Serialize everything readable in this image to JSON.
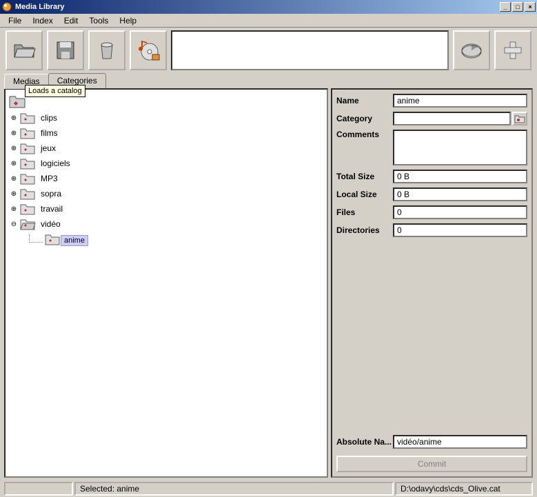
{
  "window": {
    "title": "Media Library"
  },
  "menu": {
    "file": "File",
    "index": "Index",
    "edit": "Edit",
    "tools": "Tools",
    "help": "Help"
  },
  "tooltip": "Loads a catalog",
  "tabs": {
    "medias": "Medias",
    "categories": "Categories"
  },
  "tree": {
    "items": [
      {
        "label": "clips"
      },
      {
        "label": "films"
      },
      {
        "label": "jeux"
      },
      {
        "label": "logiciels"
      },
      {
        "label": "MP3"
      },
      {
        "label": "sopra"
      },
      {
        "label": "travail"
      },
      {
        "label": "vidéo"
      }
    ],
    "child": {
      "label": "anime"
    }
  },
  "props": {
    "labels": {
      "name": "Name",
      "category": "Category",
      "comments": "Comments",
      "totalSize": "Total Size",
      "localSize": "Local Size",
      "files": "Files",
      "directories": "Directories",
      "absoluteName": "Absolute Na..."
    },
    "values": {
      "name": "anime",
      "category": "",
      "comments": "",
      "totalSize": "0 B",
      "localSize": "0 B",
      "files": "0",
      "directories": "0",
      "absoluteName": "vidéo/anime"
    },
    "commit": "Commit"
  },
  "status": {
    "selected": "Selected: anime",
    "path": "D:\\odavy\\cds\\cds_Olive.cat"
  }
}
